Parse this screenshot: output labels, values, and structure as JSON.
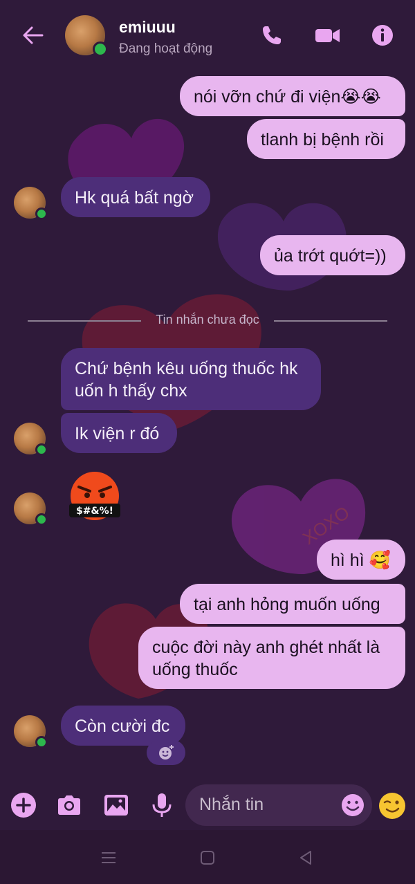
{
  "header": {
    "contact_name": "emiuuu",
    "contact_status": "Đang hoạt động"
  },
  "messages": [
    {
      "side": "out",
      "text": "nói vỡn chứ đi viện😭😭"
    },
    {
      "side": "out",
      "text": "tlanh bị bệnh rồi"
    },
    {
      "side": "in",
      "text": "Hk quá bất ngờ"
    },
    {
      "side": "out",
      "text": "ủa trớt quớt=))"
    },
    {
      "side": "in",
      "text": "Chứ bệnh kêu uống thuốc hk uốn h thấy chx"
    },
    {
      "side": "in",
      "text": "Ik viện r đó"
    },
    {
      "side": "out",
      "text": "hì hì 🥰"
    },
    {
      "side": "out",
      "text": "tại anh hỏng muốn uống"
    },
    {
      "side": "out",
      "text": "cuộc đời này anh ghét nhất là uống thuốc"
    },
    {
      "side": "in",
      "text": "Còn cười đc"
    }
  ],
  "unread_divider": "Tin nhắn chưa đọc",
  "angry_emoji_text": "$#&%!",
  "heart_text": "XOXO",
  "composer": {
    "placeholder": "Nhắn tin"
  },
  "colors": {
    "background": "#2f1a3a",
    "outgoing_bubble": "#e8b6ef",
    "incoming_bubble": "#4d2e79",
    "accent": "#e9a6f0",
    "online": "#2db84d"
  }
}
